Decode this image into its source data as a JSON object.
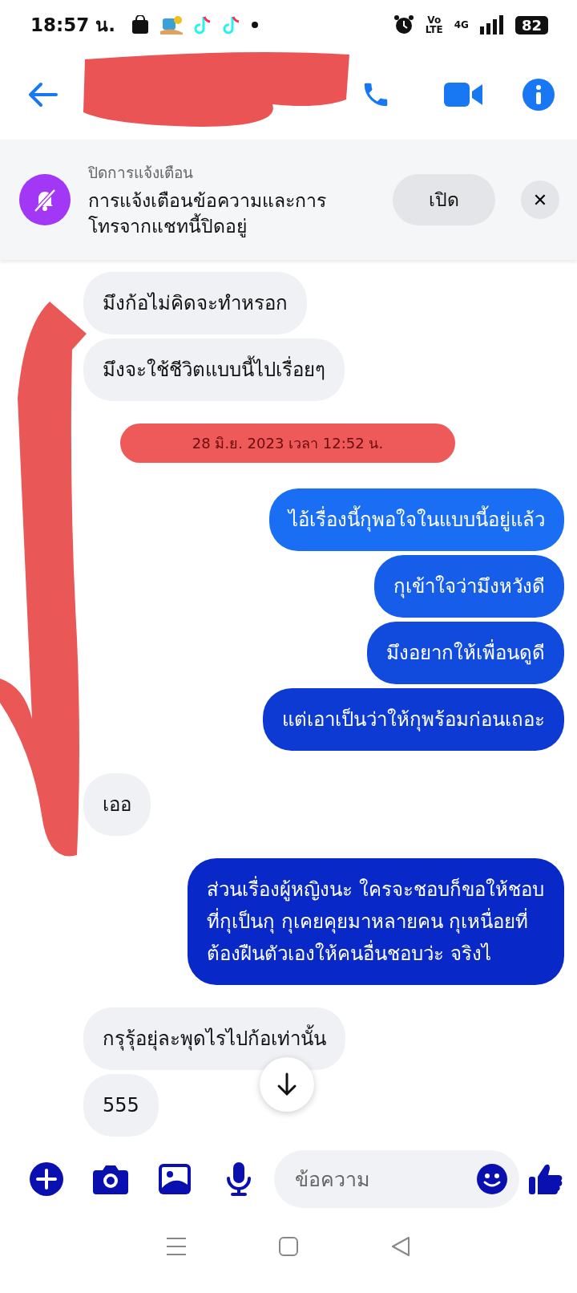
{
  "status_bar": {
    "time": "18:57 น.",
    "volte_top": "Vo",
    "volte_bottom": "LTE",
    "network": "4G",
    "battery": "82"
  },
  "banner": {
    "title": "ปิดการแจ้งเตือน",
    "message": "การแจ้งเตือนข้อความและการโทรจากแชทนี้ปิดอยู่",
    "button": "เปิด",
    "close": "✕"
  },
  "messages": [
    {
      "kind": "received",
      "text": "มึงก้อไม่คิดจะทำหรอก"
    },
    {
      "kind": "received",
      "text": "มึงจะใช้ชีวิตแบบนี้ไปเรื่อยๆ"
    },
    {
      "kind": "date",
      "text": "28 มิ.ย. 2023 เวลา 12:52 น."
    },
    {
      "kind": "sent",
      "text": "ไอ้เรื่องนี้กุพอใจในแบบนี้อยู่แล้ว"
    },
    {
      "kind": "sent",
      "text": "กุเข้าใจว่ามึงหวังดี"
    },
    {
      "kind": "sent",
      "text": "มึงอยากให้เพื่อนดูดี"
    },
    {
      "kind": "sent",
      "text": "แต่เอาเป็นว่าให้กุพร้อมก่อนเถอะ"
    },
    {
      "kind": "received",
      "text": "เออ"
    },
    {
      "kind": "sent",
      "text": "ส่วนเรื่องผู้หญิงนะ ใครจะชอบก็ขอให้ชอบที่กุเป็นกุ กุเคยคุยมาหลายคน กุเหนื่อยที่ต้องฝืนตัวเองให้คนอื่นชอบว่ะ จริงไ"
    },
    {
      "kind": "received",
      "text": "กรุรุ้อยุ่ละพุดไรไปก้อเท่านั้น"
    },
    {
      "kind": "received",
      "text": "555"
    }
  ],
  "composer": {
    "placeholder": "ข้อความ"
  }
}
